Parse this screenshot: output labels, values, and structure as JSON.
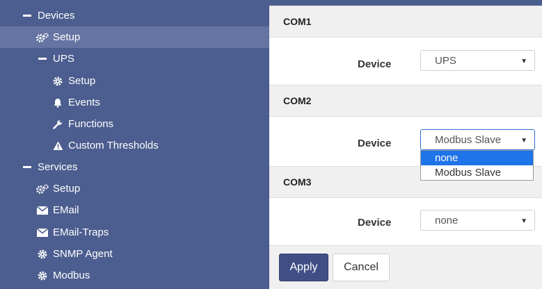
{
  "sidebar": {
    "items": [
      {
        "label": "Devices",
        "icon": "minus-icon"
      },
      {
        "label": "Setup",
        "icon": "gears-icon",
        "active": true
      },
      {
        "label": "UPS",
        "icon": "minus-icon"
      },
      {
        "label": "Setup",
        "icon": "gear-icon"
      },
      {
        "label": "Events",
        "icon": "bell-icon"
      },
      {
        "label": "Functions",
        "icon": "wrench-icon"
      },
      {
        "label": "Custom Thresholds",
        "icon": "warning-icon"
      },
      {
        "label": "Services",
        "icon": "minus-icon"
      },
      {
        "label": "Setup",
        "icon": "gears-icon"
      },
      {
        "label": "EMail",
        "icon": "envelope-icon"
      },
      {
        "label": "EMail-Traps",
        "icon": "envelope-icon"
      },
      {
        "label": "SNMP Agent",
        "icon": "gear-icon"
      },
      {
        "label": "Modbus",
        "icon": "gear-icon"
      }
    ]
  },
  "sections": [
    {
      "title": "COM1",
      "device_label": "Device",
      "selected": "UPS"
    },
    {
      "title": "COM2",
      "device_label": "Device",
      "selected": "Modbus Slave"
    },
    {
      "title": "COM3",
      "device_label": "Device",
      "selected": "none"
    }
  ],
  "dropdown": {
    "options": [
      "none",
      "Modbus Slave"
    ],
    "highlighted": "none"
  },
  "buttons": {
    "apply": "Apply",
    "cancel": "Cancel"
  },
  "colors": {
    "sidebar_bg": "#4c5d8f",
    "active_item_bg": "#6574a2",
    "primary_button": "#3f4f86",
    "dropdown_highlight": "#1e74e8"
  }
}
